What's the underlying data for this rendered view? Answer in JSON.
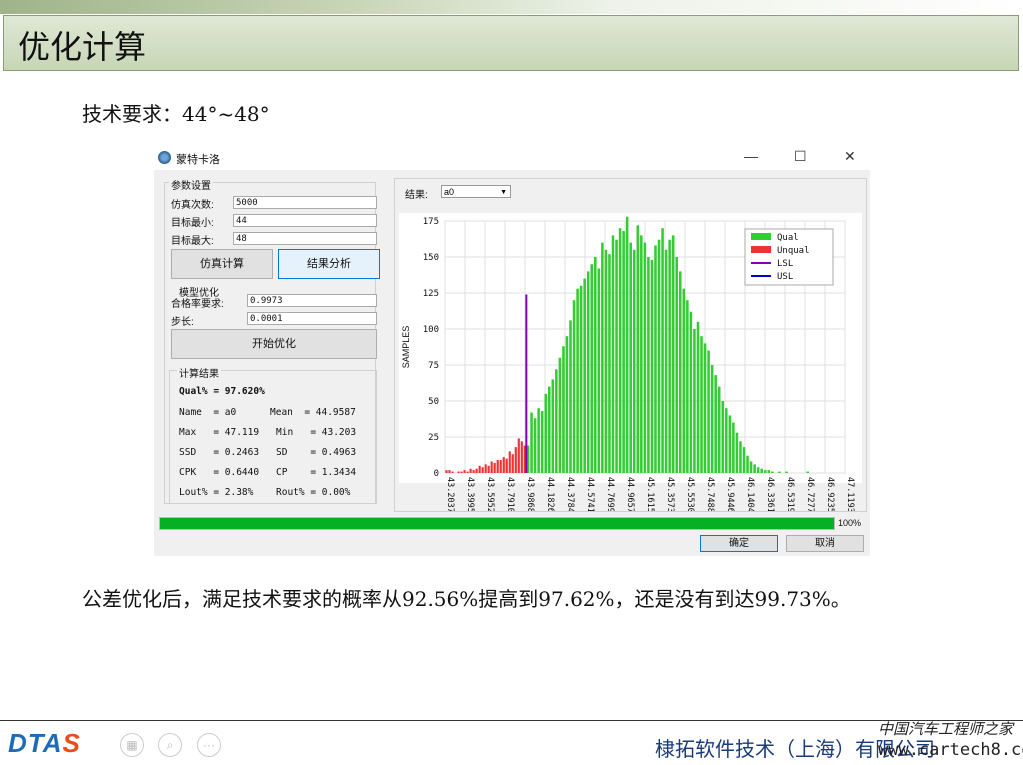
{
  "slide": {
    "title": "优化计算",
    "requirement": "技术要求：44°~48°",
    "conclusion": "公差优化后，满足技术要求的概率从92.56%提高到97.62%，还是没有到达99.73%。",
    "company": "棣拓软件技术（上海）有限公司",
    "logo_main": "DTA",
    "logo_accent": "S",
    "watermark_line1": "中国汽车工程师之家",
    "watermark_line2": "www.cartech8.com",
    "footer_icons": [
      "grid-icon",
      "zoom-icon",
      "more-icon"
    ]
  },
  "window": {
    "title": "蒙特卡洛",
    "controls": {
      "minimize": "—",
      "maximize": "☐",
      "close": "✕"
    },
    "params_group": "参数设置",
    "sim_count_label": "仿真次数:",
    "sim_count_value": "5000",
    "target_min_label": "目标最小:",
    "target_min_value": "44",
    "target_max_label": "目标最大:",
    "target_max_value": "48",
    "simulate_button": "仿真计算",
    "analyze_button": "结果分析",
    "model_group": "模型优化",
    "pass_rate_label": "合格率要求:",
    "pass_rate_value": "0.9973",
    "step_label": "步长:",
    "step_value": "0.0001",
    "optimize_button": "开始优化",
    "results_group": "计算结果",
    "qual_line": "Qual% = 97.620%",
    "stats": [
      [
        "Name  = a0",
        "Mean  = 44.9587"
      ],
      [
        "Max   = 47.119",
        "Min   = 43.203"
      ],
      [
        "SSD   = 0.2463",
        "SD    = 0.4963"
      ],
      [
        "CPK   = 0.6440",
        "CP    = 1.3434"
      ],
      [
        "Lout% = 2.38%",
        "Rout% = 0.00%"
      ]
    ],
    "result_label": "结果:",
    "result_select": "a0",
    "progress": 100,
    "progress_label": "100%",
    "ok_button": "确定",
    "cancel_button": "取消"
  },
  "chart_data": {
    "type": "bar",
    "ylabel": "SAMPLES",
    "ylim": [
      0,
      175
    ],
    "yticks": [
      0,
      25,
      50,
      75,
      100,
      125,
      150,
      175
    ],
    "xticks": [
      "43.2037",
      "43.3995",
      "43.5952",
      "43.7910",
      "43.9868",
      "44.1826",
      "44.3784",
      "44.5741",
      "44.7699",
      "44.9657",
      "45.1615",
      "45.3573",
      "45.5530",
      "45.7488",
      "45.9446",
      "46.1404",
      "46.3361",
      "46.5319",
      "46.7277",
      "46.9235",
      "47.1193"
    ],
    "xlim": [
      43.2037,
      47.1193
    ],
    "legend": [
      {
        "name": "Qual",
        "color": "#33cc33"
      },
      {
        "name": "Unqual",
        "color": "#ee3333"
      },
      {
        "name": "LSL",
        "color": "#8000c0"
      },
      {
        "name": "USL",
        "color": "#0000cc"
      }
    ],
    "legend_position": "top-right",
    "grid": true,
    "lsl": 44,
    "lsl_line_height": 124,
    "unqual_values": [
      2,
      2,
      1,
      0,
      1,
      1,
      2,
      1,
      3,
      2,
      3,
      5,
      4,
      6,
      5,
      8,
      7,
      9,
      9,
      11,
      10,
      15,
      13,
      18,
      24,
      22,
      19
    ],
    "qual_values": [
      19,
      42,
      38,
      45,
      43,
      55,
      60,
      65,
      72,
      80,
      88,
      95,
      106,
      120,
      128,
      130,
      135,
      140,
      145,
      150,
      142,
      160,
      155,
      152,
      165,
      162,
      170,
      168,
      178,
      160,
      155,
      172,
      165,
      160,
      150,
      148,
      158,
      162,
      170,
      155,
      162,
      165,
      150,
      140,
      128,
      120,
      112,
      100,
      105,
      95,
      90,
      85,
      75,
      68,
      60,
      50,
      45,
      40,
      35,
      28,
      22,
      18,
      12,
      8,
      6,
      4,
      3,
      2,
      2,
      1,
      0,
      1,
      0,
      1,
      0,
      0,
      0,
      0,
      0,
      1,
      0,
      0,
      0,
      0,
      0,
      0,
      0,
      0,
      0,
      0
    ]
  }
}
